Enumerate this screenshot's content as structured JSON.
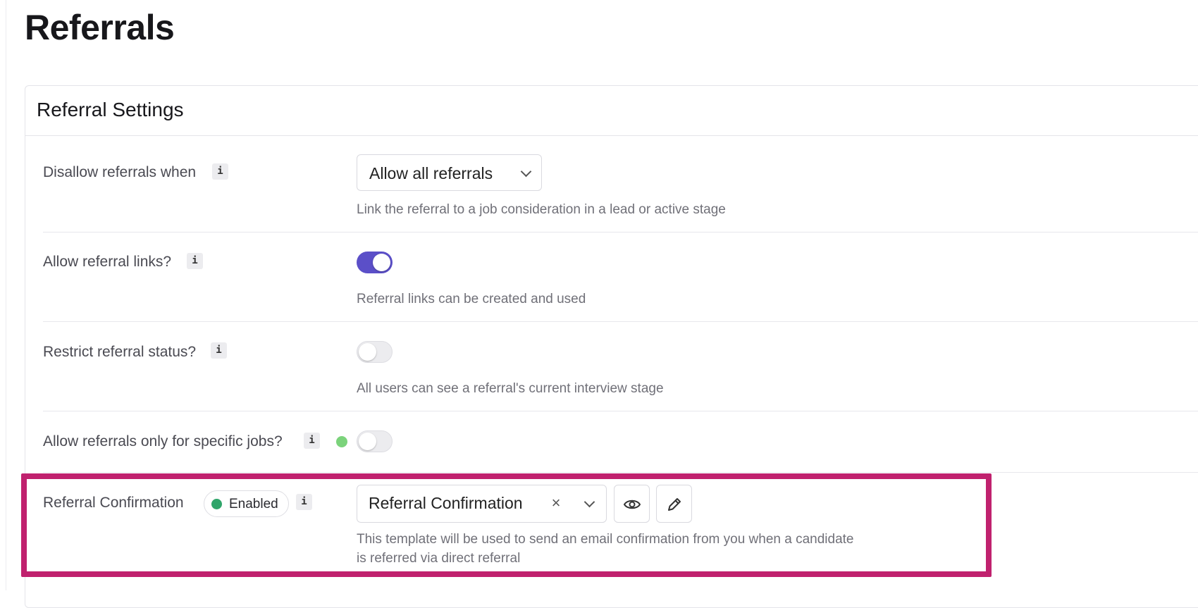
{
  "page": {
    "title": "Referrals"
  },
  "card": {
    "title": "Referral Settings"
  },
  "settings": {
    "disallow": {
      "label": "Disallow referrals when",
      "select_value": "Allow all referrals",
      "helper": "Link the referral to a job consideration in a lead or active stage"
    },
    "links": {
      "label": "Allow referral links?",
      "toggle_on": true,
      "helper": "Referral links can be created and used"
    },
    "restrict": {
      "label": "Restrict referral status?",
      "toggle_on": false,
      "helper": "All users can see a referral's current interview stage"
    },
    "specific_jobs": {
      "label": "Allow referrals only for specific jobs?",
      "toggle_on": false,
      "status_dot_color": "#7bd37b"
    },
    "confirmation": {
      "label": "Referral Confirmation",
      "badge": "Enabled",
      "badge_dot_color": "#2fa56a",
      "select_value": "Referral Confirmation",
      "clear_symbol": "×",
      "helper_line1": "This template will be used to send an email confirmation from you when a candidate",
      "helper_line2": "is referred via direct referral"
    }
  },
  "info_symbol": "i",
  "icons": [
    "info-icon",
    "chevron-down-icon",
    "close-icon",
    "eye-icon",
    "pencil-icon"
  ],
  "colors": {
    "accent": "#5b4fc8",
    "highlight": "#c0216e",
    "enabled_green": "#2fa56a"
  }
}
